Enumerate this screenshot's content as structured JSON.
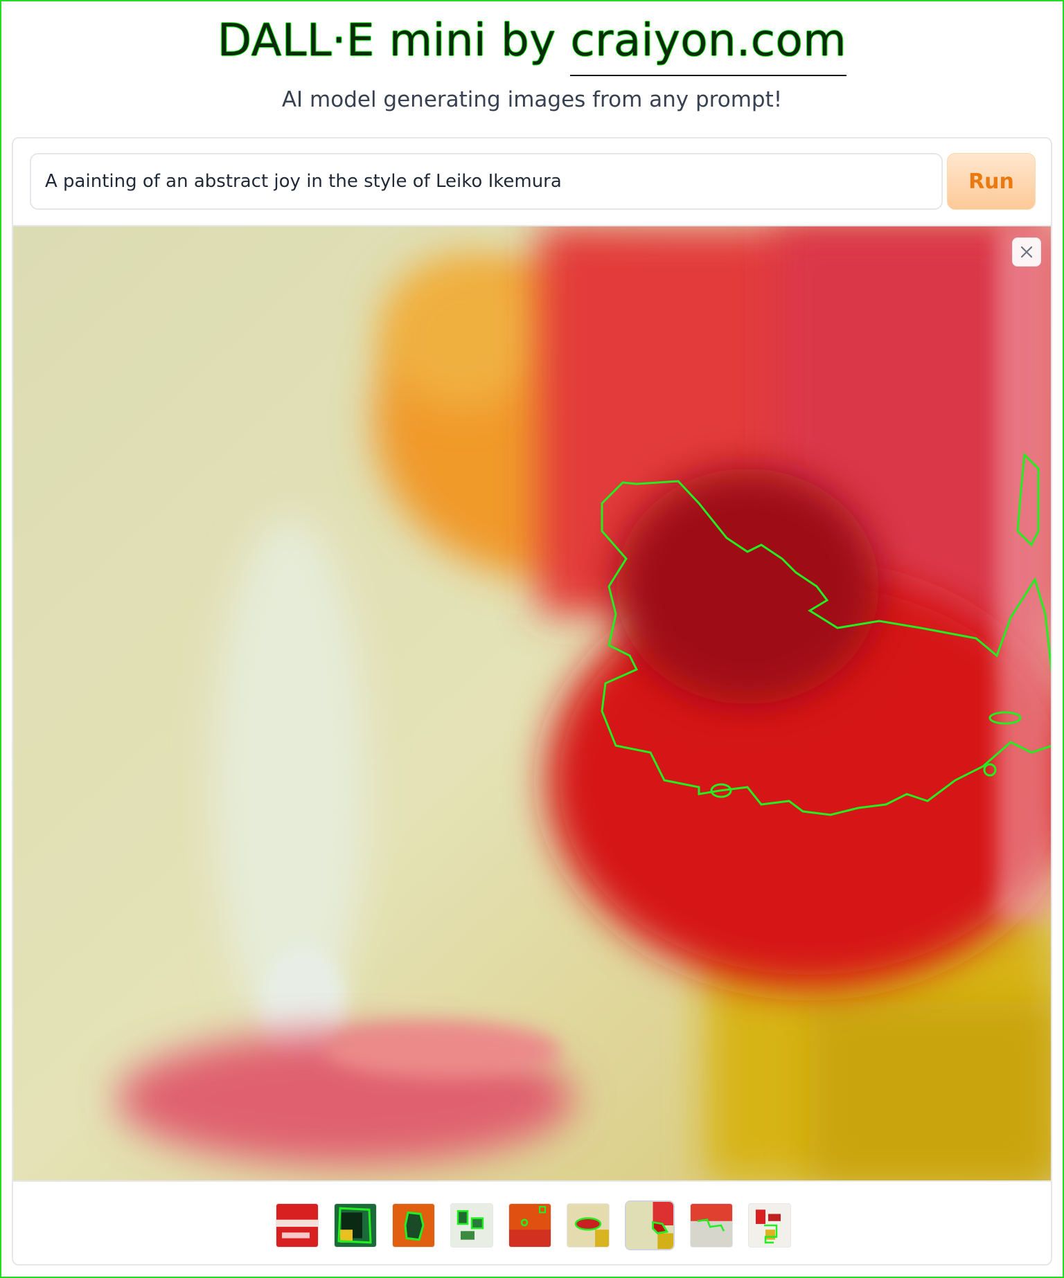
{
  "header": {
    "title_prefix": "DALL·E mini by ",
    "title_link": "craiyon.com",
    "subtitle": "AI model generating images from any prompt!"
  },
  "prompt": {
    "value": "A painting of an abstract joy in the style of Leiko Ikemura"
  },
  "run_button": {
    "label": "Run"
  },
  "gallery": {
    "count": 9,
    "selected_index": 6
  },
  "colors": {
    "accent_orange": "#ea7a10",
    "highlight_green": "#22dd22"
  },
  "icons": {
    "close": "close-icon"
  }
}
